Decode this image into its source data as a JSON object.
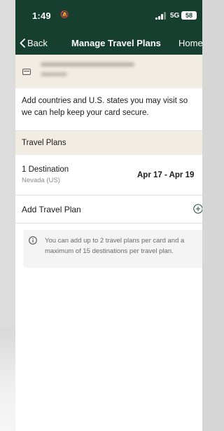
{
  "status_bar": {
    "time": "1:49",
    "network": "5G",
    "battery": "58"
  },
  "nav": {
    "back_label": "Back",
    "title": "Manage Travel Plans",
    "home_label": "Home"
  },
  "card": {
    "icon": "credit-card-icon"
  },
  "description": "Add countries and U.S. states you may visit so we can help keep your card secure.",
  "section": {
    "title": "Travel Plans"
  },
  "plans": [
    {
      "title": "1 Destination",
      "subtitle": "Nevada (US)",
      "dates": "Apr 17 - Apr 19"
    }
  ],
  "add_plan": {
    "label": "Add Travel Plan",
    "icon": "plus-circle-icon"
  },
  "info": {
    "icon": "info-icon",
    "text": "You can add up to 2 travel plans per card and a maximum of 15 destinations per travel plan."
  },
  "colors": {
    "header_bg": "#163f2f",
    "section_bg": "#f1ede5",
    "info_bg": "#f4f4f4"
  }
}
